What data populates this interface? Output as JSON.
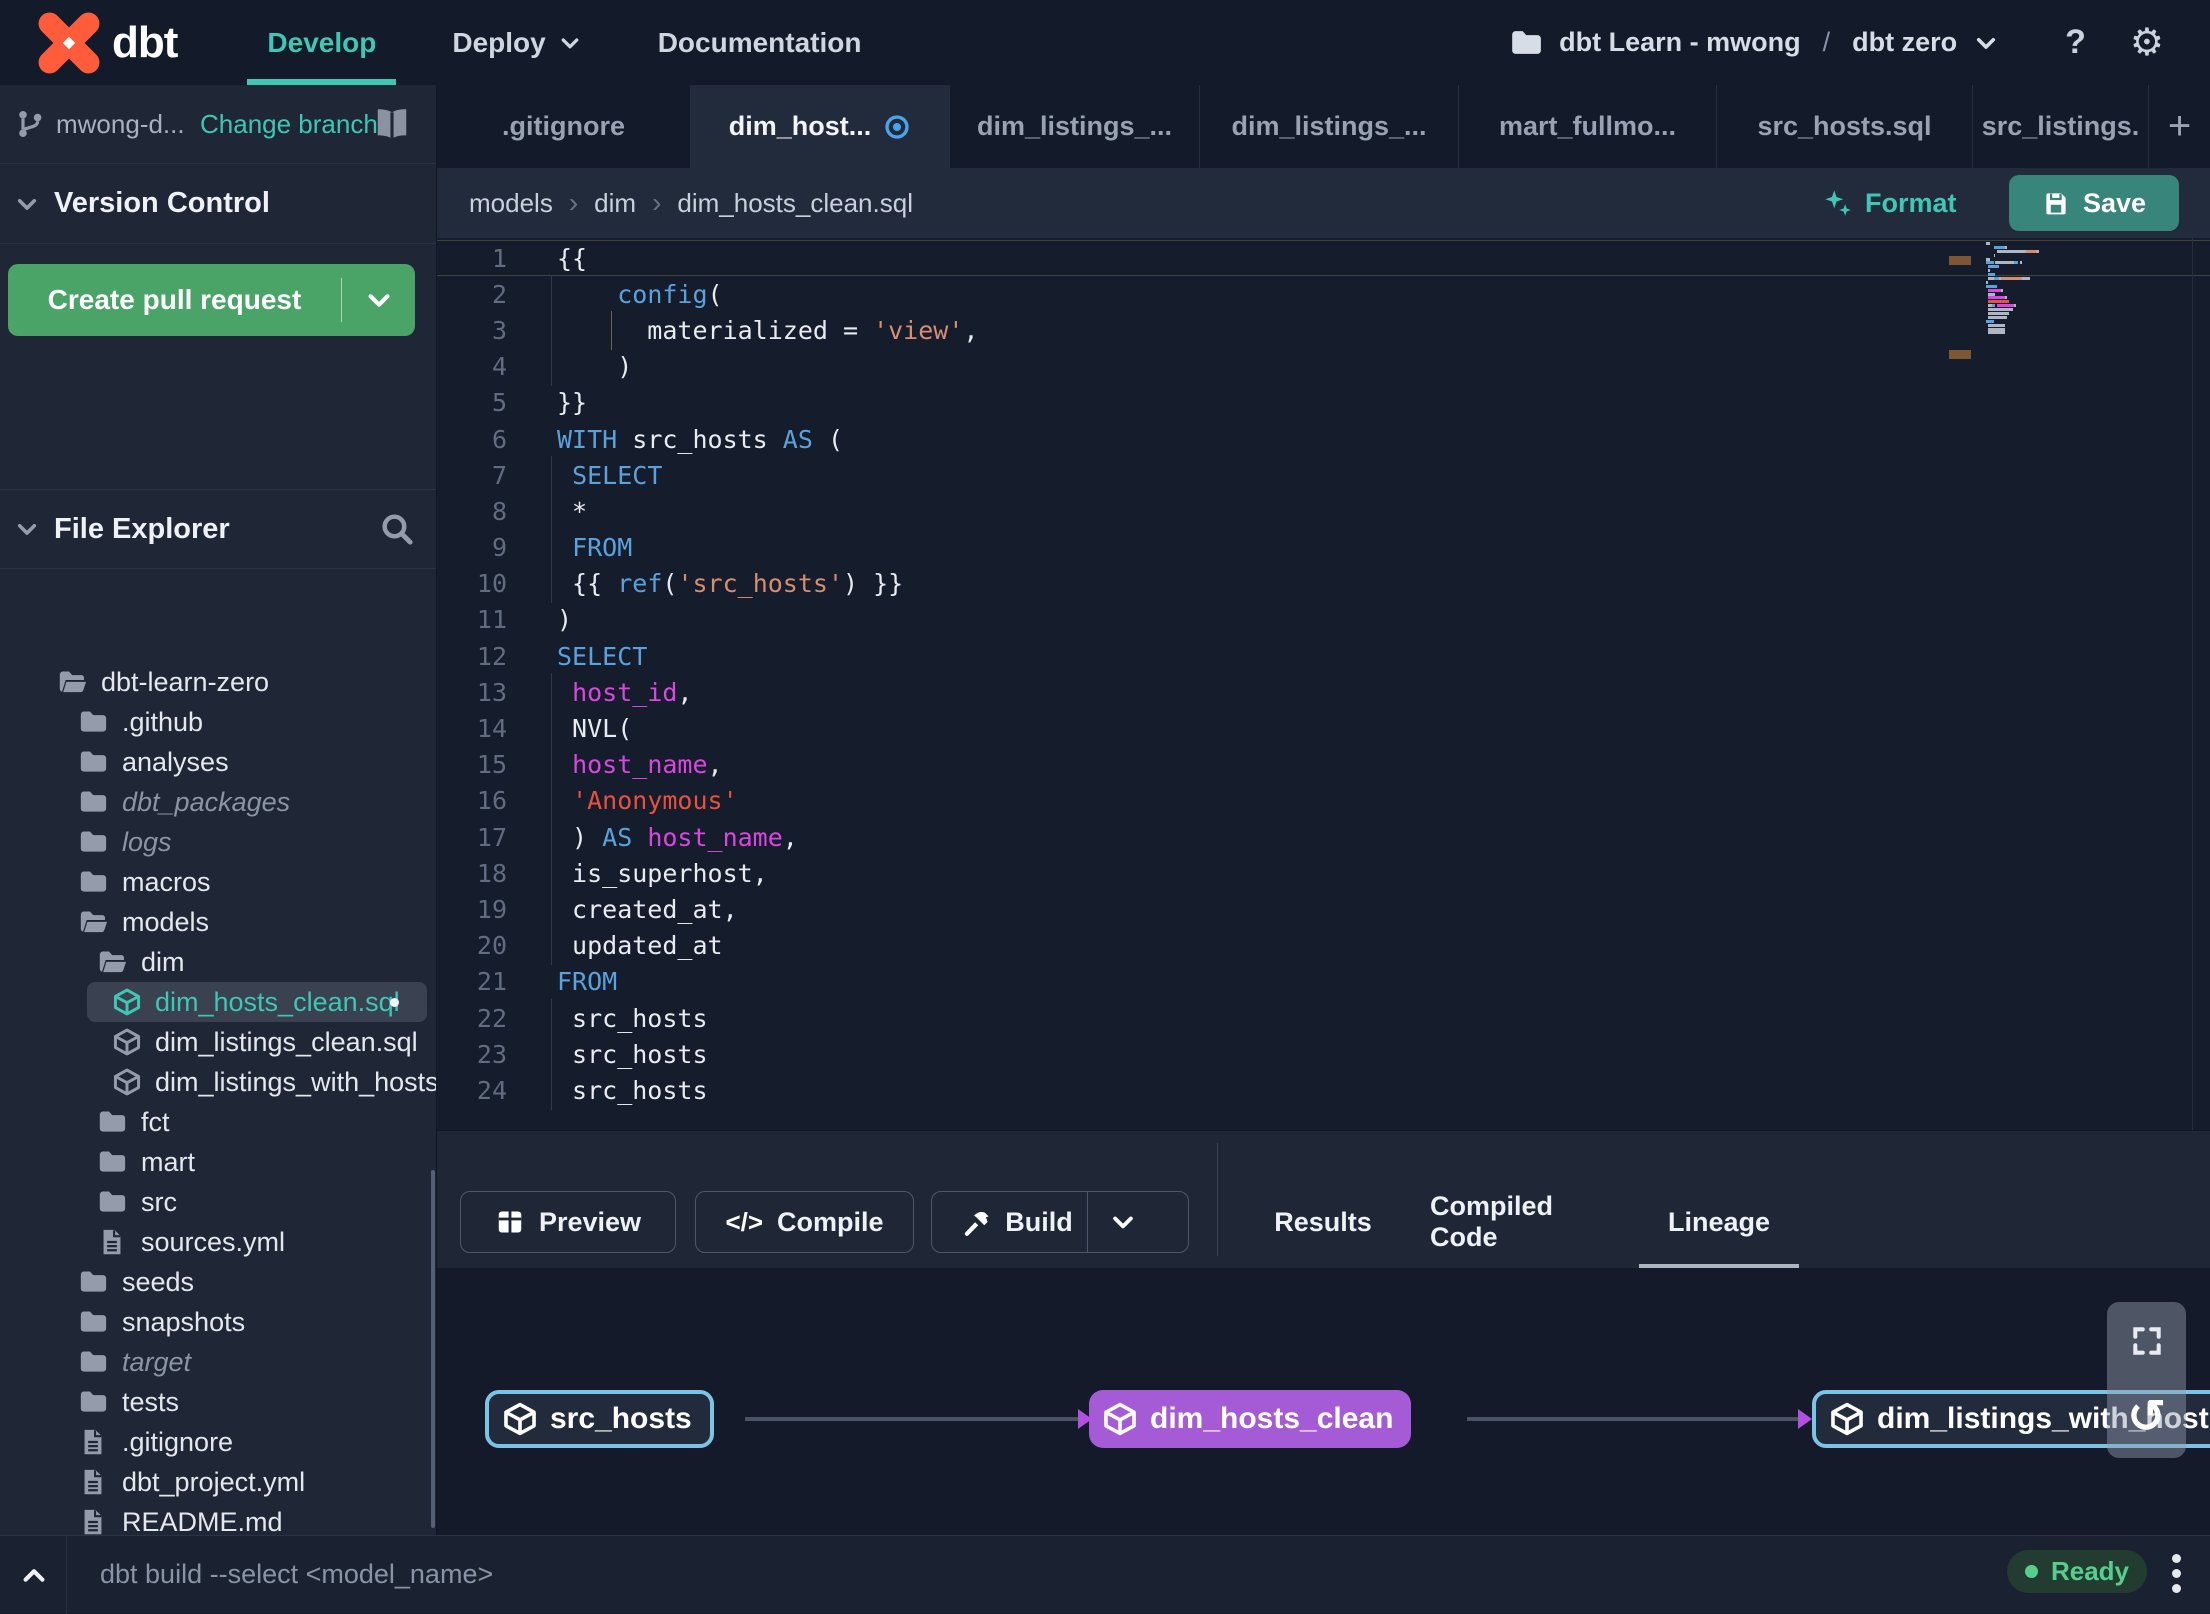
{
  "topnav": {
    "logo_text": "dbt",
    "items": [
      {
        "label": "Develop",
        "active": true,
        "dropdown": false
      },
      {
        "label": "Deploy",
        "active": false,
        "dropdown": true
      },
      {
        "label": "Documentation",
        "active": false,
        "dropdown": false
      }
    ],
    "project": {
      "name": "dbt Learn - mwong",
      "separator": "/",
      "environment": "dbt zero"
    },
    "help_label": "?"
  },
  "sidebar": {
    "branch": {
      "name": "mwong-d...",
      "change_link": "Change branch"
    },
    "version_control_title": "Version Control",
    "create_pr_label": "Create pull request",
    "file_explorer_title": "File Explorer",
    "tree": [
      {
        "label": "dbt-learn-zero",
        "icon": "folder-open",
        "level": 0
      },
      {
        "label": ".github",
        "icon": "folder",
        "level": 1
      },
      {
        "label": "analyses",
        "icon": "folder",
        "level": 1
      },
      {
        "label": "dbt_packages",
        "icon": "folder",
        "level": 1,
        "italic": true
      },
      {
        "label": "logs",
        "icon": "folder",
        "level": 1,
        "italic": true
      },
      {
        "label": "macros",
        "icon": "folder",
        "level": 1
      },
      {
        "label": "models",
        "icon": "folder-open",
        "level": 1
      },
      {
        "label": "dim",
        "icon": "folder-open",
        "level": 2
      },
      {
        "label": "dim_hosts_clean.sql",
        "icon": "model",
        "level": 3,
        "selected": true,
        "modified": true
      },
      {
        "label": "dim_listings_clean.sql",
        "icon": "model",
        "level": 3
      },
      {
        "label": "dim_listings_with_hosts...",
        "icon": "model",
        "level": 3
      },
      {
        "label": "fct",
        "icon": "folder",
        "level": 2
      },
      {
        "label": "mart",
        "icon": "folder",
        "level": 2
      },
      {
        "label": "src",
        "icon": "folder",
        "level": 2
      },
      {
        "label": "sources.yml",
        "icon": "file",
        "level": 2
      },
      {
        "label": "seeds",
        "icon": "folder",
        "level": 1
      },
      {
        "label": "snapshots",
        "icon": "folder",
        "level": 1
      },
      {
        "label": "target",
        "icon": "folder",
        "level": 1,
        "italic": true
      },
      {
        "label": "tests",
        "icon": "folder",
        "level": 1
      },
      {
        "label": ".gitignore",
        "icon": "file",
        "level": 1
      },
      {
        "label": "dbt_project.yml",
        "icon": "file",
        "level": 1
      },
      {
        "label": "README.md",
        "icon": "file",
        "level": 1
      }
    ]
  },
  "tabs": [
    {
      "label": ".gitignore"
    },
    {
      "label": "dim_host...",
      "active": true,
      "modified": true
    },
    {
      "label": "dim_listings_..."
    },
    {
      "label": "dim_listings_..."
    },
    {
      "label": "mart_fullmo..."
    },
    {
      "label": "src_hosts.sql"
    },
    {
      "label": "src_listings."
    }
  ],
  "new_tab_label": "+",
  "breadcrumb": {
    "parts": [
      "models",
      "dim",
      "dim_hosts_clean.sql"
    ],
    "format_label": "Format",
    "save_label": "Save"
  },
  "editor": {
    "lines": [
      {
        "n": "1",
        "cur": true,
        "tokens": [
          [
            "p",
            "{{"
          ]
        ]
      },
      {
        "n": "2",
        "g1": true,
        "tokens": [
          [
            "p",
            "    "
          ],
          [
            "k",
            "config"
          ],
          [
            "p",
            "("
          ]
        ]
      },
      {
        "n": "3",
        "g1": true,
        "g2": true,
        "tokens": [
          [
            "p",
            "      materialized = "
          ],
          [
            "s",
            "'view'"
          ],
          [
            "p",
            ","
          ]
        ]
      },
      {
        "n": "4",
        "g1": true,
        "tokens": [
          [
            "p",
            "    )"
          ]
        ]
      },
      {
        "n": "5",
        "tokens": [
          [
            "p",
            "}}"
          ]
        ]
      },
      {
        "n": "6",
        "tokens": [
          [
            "k",
            "WITH"
          ],
          [
            "p",
            " src_hosts "
          ],
          [
            "k",
            "AS"
          ],
          [
            "p",
            " ("
          ]
        ]
      },
      {
        "n": "7",
        "g1": true,
        "tokens": [
          [
            "p",
            " "
          ],
          [
            "k",
            "SELECT"
          ]
        ]
      },
      {
        "n": "8",
        "g1": true,
        "tokens": [
          [
            "p",
            " *"
          ]
        ]
      },
      {
        "n": "9",
        "g1": true,
        "tokens": [
          [
            "p",
            " "
          ],
          [
            "k",
            "FROM"
          ]
        ]
      },
      {
        "n": "10",
        "g1": true,
        "tokens": [
          [
            "p",
            " {{ "
          ],
          [
            "k",
            "ref"
          ],
          [
            "p",
            "("
          ],
          [
            "s",
            "'src_hosts'"
          ],
          [
            "p",
            ") }}"
          ]
        ]
      },
      {
        "n": "11",
        "tokens": [
          [
            "p",
            ")"
          ]
        ]
      },
      {
        "n": "12",
        "tokens": [
          [
            "k",
            "SELECT"
          ]
        ]
      },
      {
        "n": "13",
        "g1": true,
        "tokens": [
          [
            "p",
            " "
          ],
          [
            "c",
            "host_id"
          ],
          [
            "p",
            ","
          ]
        ]
      },
      {
        "n": "14",
        "g1": true,
        "tokens": [
          [
            "p",
            " NVL("
          ]
        ]
      },
      {
        "n": "15",
        "g1": true,
        "tokens": [
          [
            "p",
            " "
          ],
          [
            "c",
            "host_name"
          ],
          [
            "p",
            ","
          ]
        ]
      },
      {
        "n": "16",
        "g1": true,
        "tokens": [
          [
            "p",
            " "
          ],
          [
            "r",
            "'Anonymous'"
          ]
        ]
      },
      {
        "n": "17",
        "g1": true,
        "tokens": [
          [
            "p",
            " ) "
          ],
          [
            "k",
            "AS"
          ],
          [
            "p",
            " "
          ],
          [
            "c",
            "host_name"
          ],
          [
            "p",
            ","
          ]
        ]
      },
      {
        "n": "18",
        "g1": true,
        "tokens": [
          [
            "p",
            " is_superhost,"
          ]
        ]
      },
      {
        "n": "19",
        "g1": true,
        "tokens": [
          [
            "p",
            " created_at,"
          ]
        ]
      },
      {
        "n": "20",
        "g1": true,
        "tokens": [
          [
            "p",
            " updated_at"
          ]
        ]
      },
      {
        "n": "21",
        "tokens": [
          [
            "k",
            "FROM"
          ]
        ]
      },
      {
        "n": "22",
        "g1": true,
        "tokens": [
          [
            "p",
            " src_hosts"
          ]
        ]
      },
      {
        "n": "23",
        "g1": true,
        "tokens": [
          [
            "p",
            " src_hosts"
          ]
        ]
      },
      {
        "n": "24",
        "g1": true,
        "tokens": [
          [
            "p",
            " src_hosts"
          ]
        ]
      }
    ]
  },
  "panel": {
    "buttons": [
      {
        "label": "Preview",
        "icon": "grid"
      },
      {
        "label": "Compile",
        "icon": "code"
      },
      {
        "label": "Build",
        "icon": "hammer",
        "split": true
      }
    ],
    "tabs": [
      {
        "label": "Results"
      },
      {
        "label": "Compiled Code"
      },
      {
        "label": "Lineage",
        "active": true
      }
    ]
  },
  "lineage": {
    "nodes": [
      {
        "label": "src_hosts",
        "style": "source"
      },
      {
        "label": "dim_hosts_clean",
        "style": "model"
      },
      {
        "label": "dim_listings_with_hosts",
        "style": "source"
      }
    ],
    "edges": [
      {
        "from": "src_hosts",
        "to": "dim_hosts_clean"
      },
      {
        "from": "dim_hosts_clean",
        "to": "dim_listings_with_hosts"
      }
    ]
  },
  "statusbar": {
    "command": "dbt build --select <model_name>",
    "status": "Ready"
  },
  "colors": {
    "accent_teal": "#3fc6b4",
    "brand_orange": "#ff5c3c",
    "save_teal": "#37857b",
    "pr_green": "#4aa468",
    "ready_green": "#57cf8c",
    "node_blue": "#7cc4e6",
    "node_purple": "#a55bd5",
    "code_keyword": "#5ba2dc",
    "code_string_jinja": "#d78d70",
    "code_string_sql": "#e8503f",
    "code_column": "#d948de"
  }
}
